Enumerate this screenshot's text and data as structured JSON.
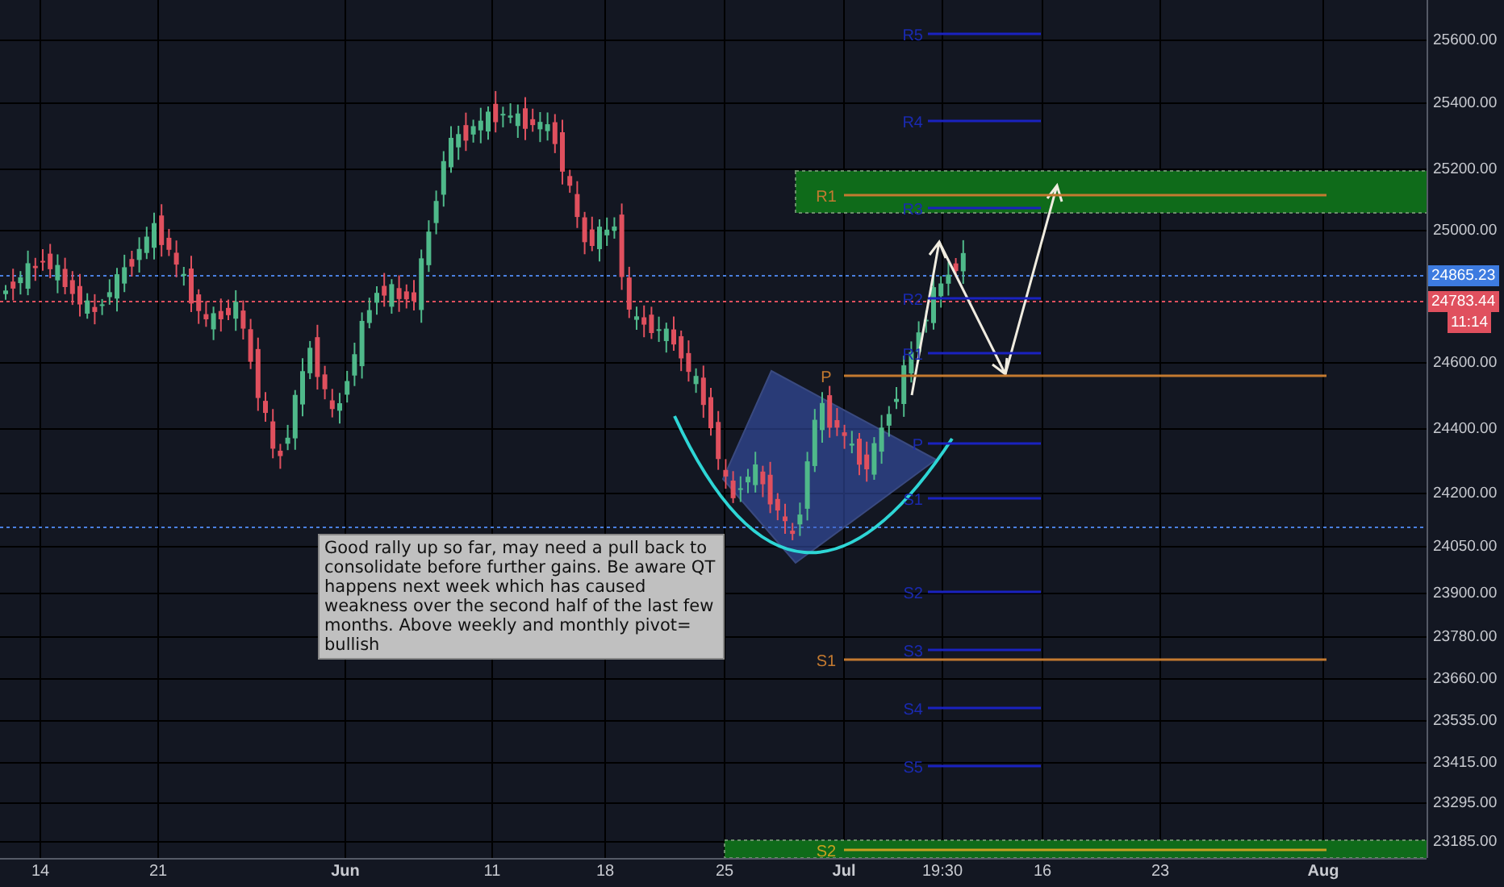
{
  "price_axis": {
    "ticks": [
      "25600.00",
      "25400.00",
      "25200.00",
      "25000.00",
      "24600.00",
      "24400.00",
      "24200.00",
      "24050.00",
      "23900.00",
      "23780.00",
      "23660.00",
      "23535.00",
      "23415.00",
      "23295.00",
      "23185.00"
    ],
    "tags": [
      {
        "label": "24865.23",
        "color": "#3d7be0"
      },
      {
        "label": "24783.44",
        "color": "#e0505e"
      },
      {
        "label": "11:14",
        "color": "#e0505e"
      }
    ]
  },
  "time_axis": {
    "ticks": [
      "14",
      "21",
      "Jun",
      "11",
      "18",
      "25",
      "Jul",
      "19:30",
      "16",
      "23",
      "Aug"
    ]
  },
  "pivots": [
    {
      "label": "R1",
      "kind": "monthly"
    },
    {
      "label": "P",
      "kind": "monthly"
    },
    {
      "label": "S1",
      "kind": "monthly"
    },
    {
      "label": "S2",
      "kind": "monthly"
    },
    {
      "label": "R5",
      "kind": "weekly"
    },
    {
      "label": "R4",
      "kind": "weekly"
    },
    {
      "label": "R3",
      "kind": "weekly"
    },
    {
      "label": "R2",
      "kind": "weekly"
    },
    {
      "label": "R1",
      "kind": "weekly"
    },
    {
      "label": "P",
      "kind": "weekly"
    },
    {
      "label": "S1",
      "kind": "weekly"
    },
    {
      "label": "S2",
      "kind": "weekly"
    },
    {
      "label": "S3",
      "kind": "weekly"
    },
    {
      "label": "S4",
      "kind": "weekly"
    },
    {
      "label": "S5",
      "kind": "weekly"
    }
  ],
  "note": {
    "text": "Good rally up so far, may need a pull back to consolidate before further gains. Be aware QT happens next week which has caused weakness over the second half of the last few months. Above weekly and monthly pivot= bullish"
  }
}
